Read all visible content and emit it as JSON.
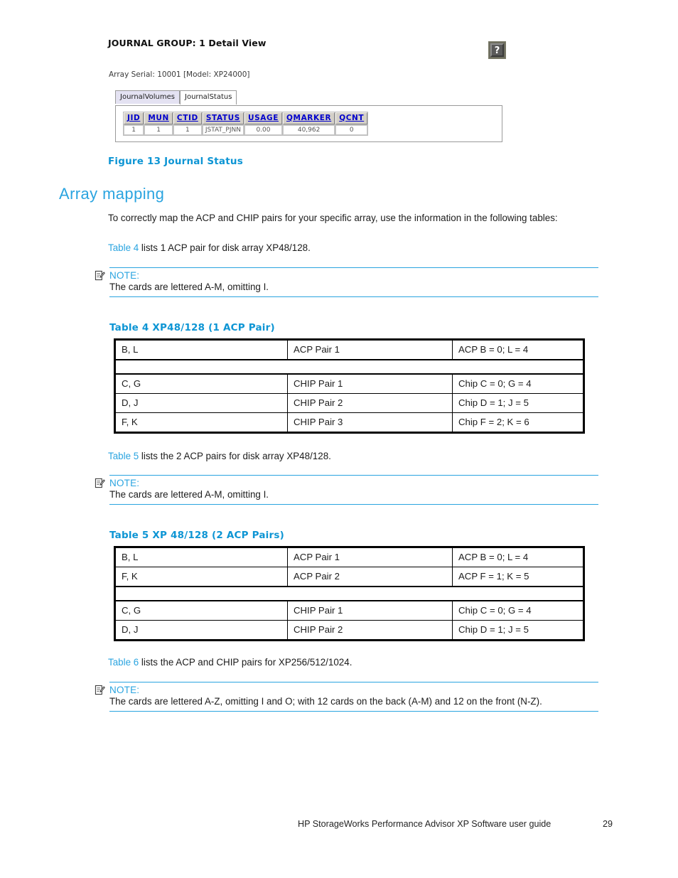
{
  "figure": {
    "window_title": "JOURNAL GROUP: 1 Detail View",
    "help_icon_label": "?",
    "array_serial": "Array Serial: 10001 [Model: XP24000]",
    "tabs": [
      {
        "label": "JournalVolumes",
        "active": false
      },
      {
        "label": "JournalStatus",
        "active": true
      }
    ],
    "grid": {
      "columns": [
        "JID",
        "MUN",
        "CTID",
        "STATUS",
        "USAGE",
        "QMARKER",
        "QCNT"
      ],
      "rows": [
        [
          "1",
          "1",
          "1",
          "JSTAT_PJNN",
          "0.00",
          "40,962",
          "0"
        ]
      ]
    },
    "caption": "Figure 13 Journal Status"
  },
  "section": {
    "heading": "Array mapping",
    "intro": "To correctly map the ACP and CHIP pairs for your specific array, use the information in the following tables:",
    "xref4_link": "Table 4",
    "xref4_rest": " lists 1 ACP pair for disk array XP48/128.",
    "xref5_link": "Table 5",
    "xref5_rest": " lists the 2 ACP pairs for disk array XP48/128.",
    "xref6_link": "Table 6",
    "xref6_rest": " lists the ACP and CHIP pairs for XP256/512/1024."
  },
  "notes": [
    {
      "label": "NOTE:",
      "text": "The cards are lettered A-M, omitting I."
    },
    {
      "label": "NOTE:",
      "text": "The cards are lettered A-M, omitting I."
    },
    {
      "label": "NOTE:",
      "text": "The cards are lettered A-Z, omitting I and O; with 12 cards on the back (A-M) and 12 on the front (N-Z)."
    }
  ],
  "table4": {
    "caption": "Table 4 XP48/128 (1 ACP Pair)",
    "rows": [
      [
        "B, L",
        "ACP Pair 1",
        "ACP B = 0; L = 4"
      ],
      [
        "",
        "",
        ""
      ],
      [
        "C, G",
        "CHIP Pair 1",
        "Chip C = 0; G = 4"
      ],
      [
        "D, J",
        "CHIP Pair 2",
        "Chip D = 1; J = 5"
      ],
      [
        "F, K",
        "CHIP Pair 3",
        "Chip F = 2; K = 6"
      ]
    ]
  },
  "table5": {
    "caption": "Table 5 XP 48/128 (2 ACP Pairs)",
    "rows": [
      [
        "B, L",
        "ACP Pair 1",
        "ACP B = 0; L = 4"
      ],
      [
        "F, K",
        "ACP Pair 2",
        "ACP F = 1; K = 5"
      ],
      [
        "",
        "",
        ""
      ],
      [
        "C, G",
        "CHIP Pair 1",
        "Chip C = 0; G = 4"
      ],
      [
        "D, J",
        "CHIP Pair 2",
        "Chip D = 1; J = 5"
      ]
    ]
  },
  "footer": {
    "guide_title": "HP StorageWorks Performance Advisor XP Software user guide",
    "page_number": "29"
  },
  "colors": {
    "hp_blue": "#2aa4e0",
    "caption_blue": "#0d95d4",
    "grid_header_link": "#0000cc"
  }
}
